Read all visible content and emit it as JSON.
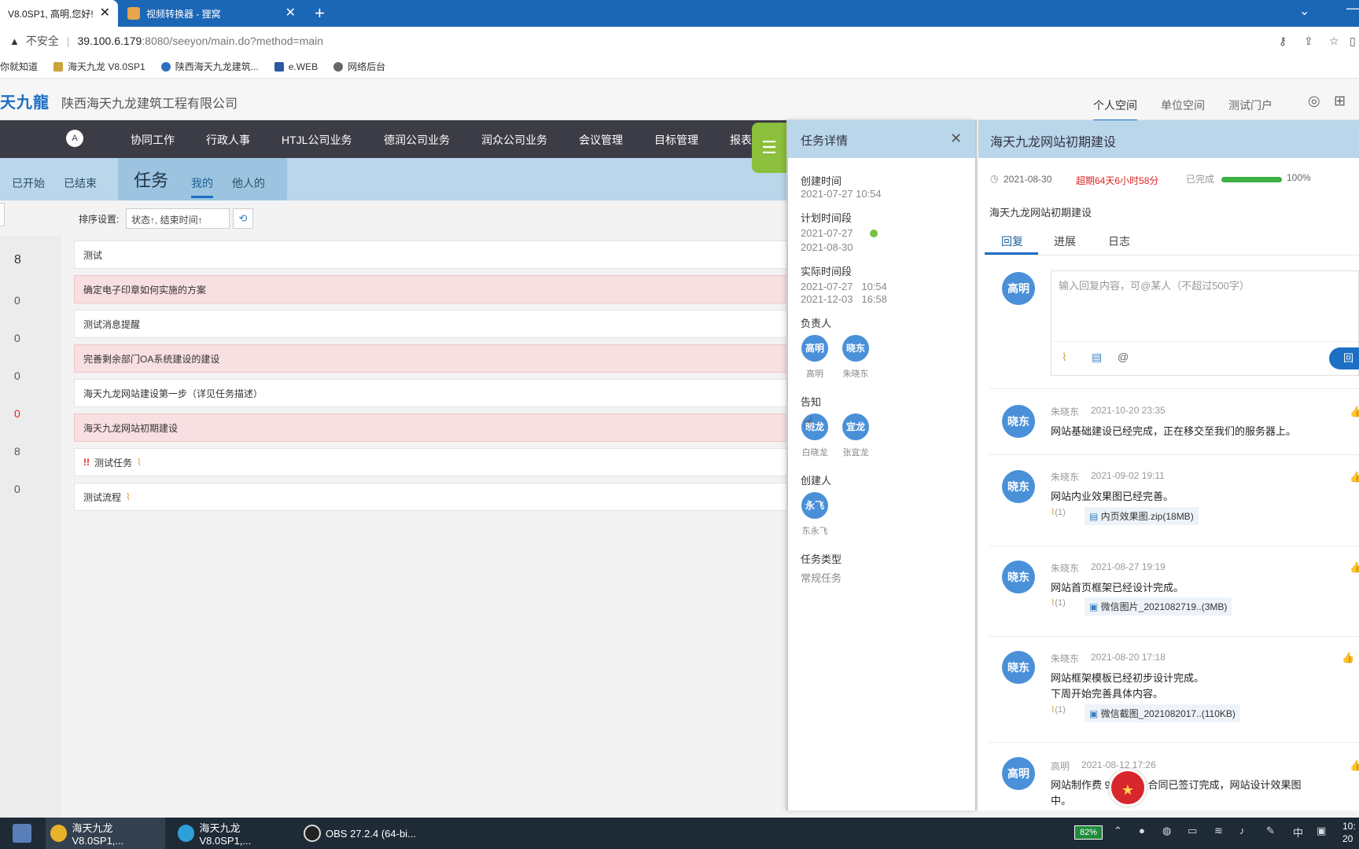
{
  "browser": {
    "tabs": [
      {
        "label": "V8.0SP1, 高明,您好!",
        "close": "✕"
      },
      {
        "label": "视频转换器 - 狸窝",
        "close": "✕"
      }
    ],
    "new_tab": "+",
    "address": {
      "warning": "不安全",
      "host": "39.100.6.179",
      "rest": ":8080/seeyon/main.do?method=main"
    },
    "bookmarks": [
      "你就知道",
      "海天九龙 V8.0SP1",
      "陕西海天九龙建筑...",
      "e.WEB",
      "网络后台"
    ]
  },
  "app": {
    "logo": "天九龍",
    "company": "陕西海天九龙建筑工程有限公司",
    "spaces": [
      "个人空间",
      "单位空间",
      "测试门户"
    ],
    "home": "A",
    "nav": [
      "协同工作",
      "行政人事",
      "HTJL公司业务",
      "德润公司业务",
      "润众公司业务",
      "会议管理",
      "目标管理",
      "报表"
    ],
    "sub": {
      "started": "已开始",
      "ended": "已结束",
      "title": "任务",
      "mine": "我的",
      "others": "他人的"
    },
    "sort": {
      "label": "排序设置:",
      "value": "状态↑, 结束时间↑"
    },
    "counts": [
      "8",
      "0",
      "0",
      "0",
      "0",
      "8",
      "0"
    ],
    "tasks": [
      {
        "title": "测试",
        "red": false
      },
      {
        "title": "确定电子印章如何实施的方案",
        "red": true
      },
      {
        "title": "测试消息提醒",
        "red": false
      },
      {
        "title": "完善剩余部门OA系统建设的建设",
        "red": true
      },
      {
        "title": "海天九龙网站建设第一步（详见任务描述）",
        "red": false
      },
      {
        "title": "海天九龙网站初期建设",
        "red": true
      },
      {
        "title": "测试任务",
        "red": false
      },
      {
        "title": "测试流程",
        "red": false
      }
    ]
  },
  "detail": {
    "title": "任务详情",
    "created_label": "创建时间",
    "created": "2021-07-27 10:54",
    "plan_label": "计划时间段",
    "plan_start": "2021-07-27",
    "plan_end": "2021-08-30",
    "actual_label": "实际时间段",
    "actual_start": "2021-07-27   10:54",
    "actual_end": "2021-12-03   16:58",
    "owner_label": "负责人",
    "owners": [
      {
        "av": "高明",
        "name": "高明"
      },
      {
        "av": "晓东",
        "name": "朱晓东"
      }
    ],
    "notify_label": "告知",
    "notify": [
      {
        "av": "晓龙",
        "name": "白晓龙"
      },
      {
        "av": "宜龙",
        "name": "张宜龙"
      }
    ],
    "creator_label": "创建人",
    "creator": {
      "av": "永飞",
      "name": "东永飞"
    },
    "type_label": "任务类型",
    "type": "常规任务"
  },
  "right": {
    "title": "海天九龙网站初期建设",
    "date": "2021-08-30",
    "overdue": "超期64天6小时58分",
    "done_label": "已完成",
    "progress_pct": 100,
    "progress": "100%",
    "subtitle": "海天九龙网站初期建设",
    "tabs": [
      "回复",
      "进展",
      "日志"
    ],
    "reply_avatar": "高明",
    "reply_placeholder": "输入回复内容，可@某人（不超过500字）",
    "send": "回",
    "comments": [
      {
        "av": "晓东",
        "name": "朱晓东",
        "time": "2021-10-20 23:35",
        "text": "网站基础建设已经完成，正在移交至我们的服务器上。",
        "text2": "",
        "att_count": "",
        "att": ""
      },
      {
        "av": "晓东",
        "name": "朱晓东",
        "time": "2021-09-02 19:11",
        "text": "网站内业效果图已经完善。",
        "text2": "",
        "att_count": "(1)",
        "att": "内页效果图.zip(18MB)"
      },
      {
        "av": "晓东",
        "name": "朱晓东",
        "time": "2021-08-27 19:19",
        "text": "网站首页框架已经设计完成。",
        "text2": "",
        "att_count": "(1)",
        "att": "微信图片_2021082719..(3MB)"
      },
      {
        "av": "晓东",
        "name": "朱晓东",
        "time": "2021-08-20 17:18",
        "text": "网站框架模板已经初步设计完成。",
        "text2": "下周开始完善具体内容。",
        "att_count": "(1)",
        "att": "微信截图_2021082017..(110KB)"
      },
      {
        "av": "高明",
        "name": "高明",
        "time": "2021-08-12 17:26",
        "text": "网站制作费 9400元。合同已签订完成，网站设计效果图",
        "text2": "中。",
        "att_count": "",
        "att": ""
      }
    ]
  },
  "taskbar": {
    "items": [
      "海天九龙 V8.0SP1,...",
      "海天九龙 V8.0SP1,...",
      "OBS 27.2.4 (64-bi..."
    ],
    "battery": "82%",
    "ime": "中",
    "time": "10:",
    "date": "20"
  }
}
